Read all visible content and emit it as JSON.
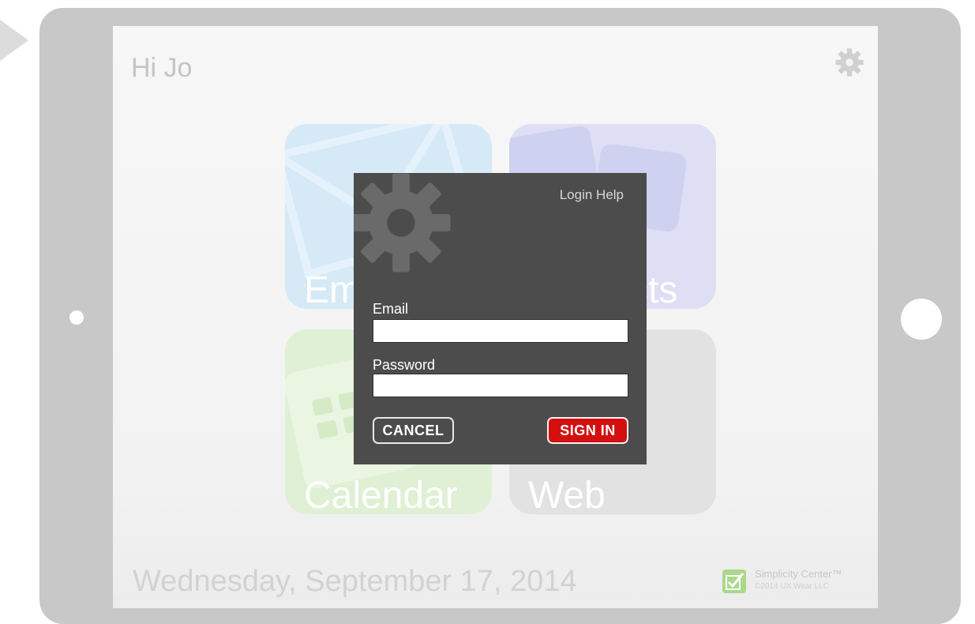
{
  "header": {
    "greeting": "Hi Jo"
  },
  "tiles": [
    {
      "label": "Email"
    },
    {
      "label": "Contacts"
    },
    {
      "label": "Calendar"
    },
    {
      "label": "Web"
    }
  ],
  "footer": {
    "date": "Wednesday, September 17, 2014",
    "brand_name": "Simplicity Center™",
    "brand_copyright": "©2014 UX Wear LLC"
  },
  "login_dialog": {
    "help_link": "Login Help",
    "email_label": "Email",
    "email_value": "",
    "password_label": "Password",
    "password_value": "",
    "cancel_label": "CANCEL",
    "signin_label": "SIGN IN"
  },
  "icons": {
    "settings": "gear-icon",
    "back": "back-arrow-icon",
    "dialog_decoration": "gear-icon",
    "brand": "checkmark-logo-icon"
  },
  "colors": {
    "dialog_background": "#4c4c4c",
    "sign_in": "#d40f0f",
    "email_tile": "#d6e9f6",
    "contacts_tile": "#dedff5",
    "calendar_tile": "#dff0d4",
    "web_tile": "#e2e2e2"
  }
}
